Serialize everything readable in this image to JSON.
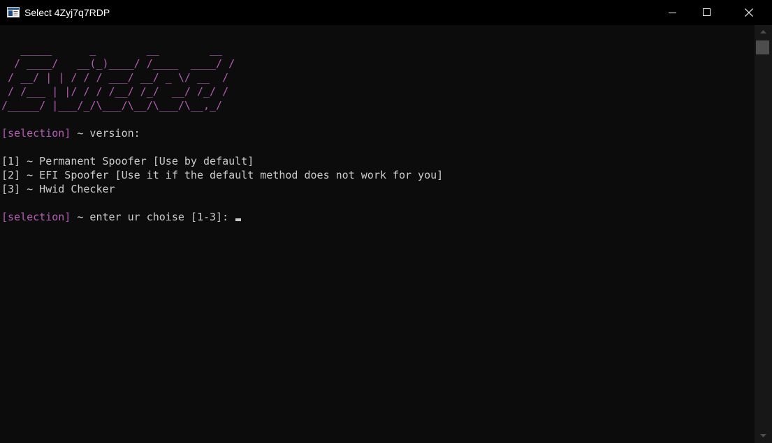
{
  "window": {
    "title": "Select 4Zyj7q7RDP",
    "icon": "console-window-icon",
    "buttons": [
      "minimize-icon",
      "maximize-icon",
      "close-icon"
    ]
  },
  "colors": {
    "background": "#0c0c0c",
    "text": "#cccccc",
    "accent_magenta": "#b55cb6",
    "titlebar": "#000000"
  },
  "banner": {
    "lines": [
      "   _____      _        __        __",
      "  / ____/   __(_)____/ /____  ____/ /",
      " / __/ | | / / / ___/ __/ _ \\/ __  /",
      " / /___ | |/ / / /__/ /_/  __/ /_/ /",
      "/_____/ |___/_/\\___/\\__/\\___/\\__,_/"
    ]
  },
  "prompt1": {
    "tag": "[selection]",
    "text": " ~ version:"
  },
  "menu": [
    {
      "key": "[1]",
      "text": " ~ Permanent Spoofer [Use by default]"
    },
    {
      "key": "[2]",
      "text": " ~ EFI Spoofer [Use it if the default method does not work for you]"
    },
    {
      "key": "[3]",
      "text": " ~ Hwid Checker"
    }
  ],
  "prompt2": {
    "tag": "[selection]",
    "text": " ~ enter ur choise [1-3]: "
  }
}
